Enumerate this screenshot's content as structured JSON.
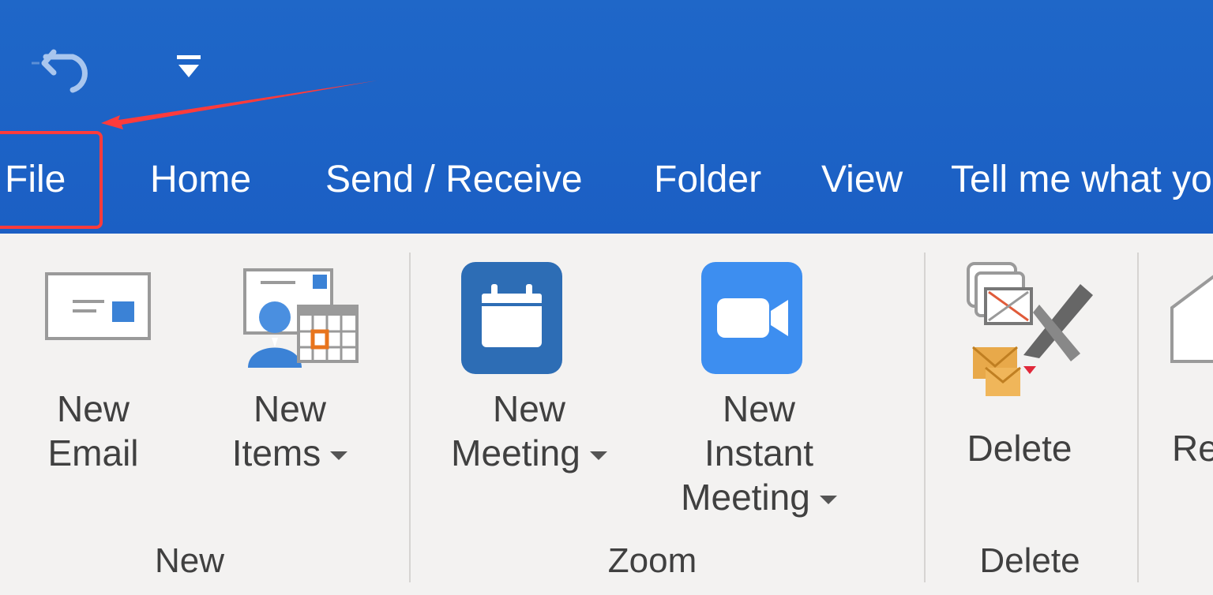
{
  "tabs": {
    "file": "File",
    "home": "Home",
    "send_receive": "Send / Receive",
    "folder": "Folder",
    "view": "View",
    "tell_me": "Tell me what yo"
  },
  "quick_access": {
    "undo_icon": "undo-icon",
    "customize_icon": "customize-quick-access-icon"
  },
  "ribbon": {
    "new_email": {
      "line1": "New",
      "line2": "Email"
    },
    "new_items": {
      "line1": "New",
      "line2": "Items"
    },
    "new_meeting": {
      "line1": "New",
      "line2": "Meeting"
    },
    "new_instant_meeting": {
      "line1": "New",
      "line2": "Instant",
      "line3": "Meeting"
    },
    "delete": {
      "label": "Delete"
    },
    "partial": {
      "label": "Re"
    }
  },
  "groups": {
    "new": "New",
    "zoom": "Zoom",
    "delete": "Delete"
  },
  "colors": {
    "title_bar": "#1f67c8",
    "ribbon_bg": "#f3f2f1",
    "annotation": "#ff3b3b",
    "zoom_meeting": "#2d6db5",
    "zoom_instant": "#3d8ef0"
  }
}
